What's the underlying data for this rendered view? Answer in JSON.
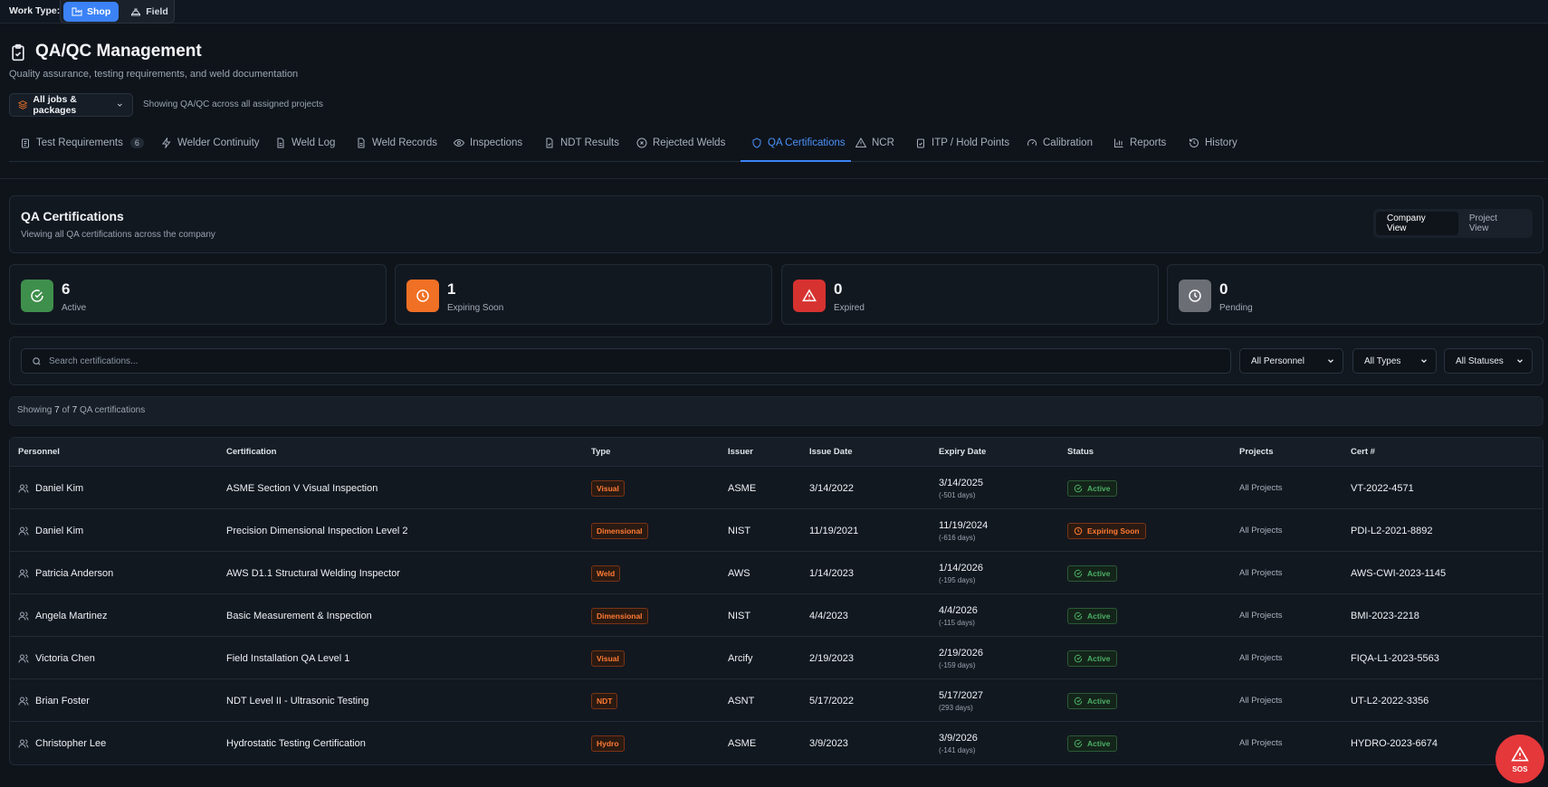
{
  "work_type": {
    "label": "Work Type:",
    "options": [
      {
        "label": "Shop",
        "icon": "factory-icon",
        "active": true
      },
      {
        "label": "Field",
        "icon": "hardhat-icon",
        "active": false
      }
    ]
  },
  "header": {
    "title": "QA/QC Management",
    "subtitle": "Quality assurance, testing requirements, and weld documentation",
    "scope_button": "All jobs & packages",
    "scope_note": "Showing QA/QC across all assigned projects"
  },
  "tabs": [
    {
      "label": "Test Requirements",
      "count": "6",
      "icon": "clipboard-icon"
    },
    {
      "label": "Welder Continuity",
      "icon": "zap-icon"
    },
    {
      "label": "Weld Log",
      "icon": "file-icon"
    },
    {
      "label": "Weld Records",
      "icon": "file-icon"
    },
    {
      "label": "Inspections",
      "icon": "eye-icon"
    },
    {
      "label": "NDT Results",
      "icon": "file-check-icon"
    },
    {
      "label": "Rejected Welds",
      "icon": "x-circle-icon"
    },
    {
      "label": "QA Certifications",
      "icon": "shield-icon",
      "active": true
    },
    {
      "label": "NCR",
      "icon": "warning-icon"
    },
    {
      "label": "ITP / Hold Points",
      "icon": "clipboard-check-icon"
    },
    {
      "label": "Calibration",
      "icon": "gauge-icon"
    },
    {
      "label": "Reports",
      "icon": "bar-chart-icon"
    },
    {
      "label": "History",
      "icon": "history-icon"
    }
  ],
  "section": {
    "title": "QA Certifications",
    "subtitle": "Viewing all QA certifications across the company",
    "views": [
      {
        "label": "Company View",
        "active": true
      },
      {
        "label": "Project View",
        "active": false
      }
    ]
  },
  "stats": [
    {
      "value": "6",
      "label": "Active",
      "color": "#3f8f4c",
      "icon": "check-circle-icon"
    },
    {
      "value": "1",
      "label": "Expiring Soon",
      "color": "#f07025",
      "icon": "clock-icon"
    },
    {
      "value": "0",
      "label": "Expired",
      "color": "#d63230",
      "icon": "warning-icon"
    },
    {
      "value": "0",
      "label": "Pending",
      "color": "#6b6f75",
      "icon": "clock-icon"
    }
  ],
  "filters": {
    "search_placeholder": "Search certifications...",
    "personnel": "All Personnel",
    "types": "All Types",
    "statuses": "All Statuses"
  },
  "showing": {
    "prefix": "Showing ",
    "shown": "7",
    "mid": " of ",
    "total": "7",
    "suffix": " QA certifications"
  },
  "table": {
    "headers": [
      "Personnel",
      "Certification",
      "Type",
      "Issuer",
      "Issue Date",
      "Expiry Date",
      "Status",
      "Projects",
      "Cert #"
    ],
    "rows": [
      {
        "personnel": "Daniel Kim",
        "certification": "ASME Section V Visual Inspection",
        "type": "Visual",
        "issuer": "ASME",
        "issue_date": "3/14/2022",
        "expiry_date": "3/14/2025",
        "expiry_days": "(-501 days)",
        "status": "Active",
        "projects": "All Projects",
        "cert_no": "VT-2022-4571"
      },
      {
        "personnel": "Daniel Kim",
        "certification": "Precision Dimensional Inspection Level 2",
        "type": "Dimensional",
        "issuer": "NIST",
        "issue_date": "11/19/2021",
        "expiry_date": "11/19/2024",
        "expiry_days": "(-616 days)",
        "status": "Expiring Soon",
        "projects": "All Projects",
        "cert_no": "PDI-L2-2021-8892"
      },
      {
        "personnel": "Patricia Anderson",
        "certification": "AWS D1.1 Structural Welding Inspector",
        "type": "Weld",
        "issuer": "AWS",
        "issue_date": "1/14/2023",
        "expiry_date": "1/14/2026",
        "expiry_days": "(-195 days)",
        "status": "Active",
        "projects": "All Projects",
        "cert_no": "AWS-CWI-2023-1145"
      },
      {
        "personnel": "Angela Martinez",
        "certification": "Basic Measurement & Inspection",
        "type": "Dimensional",
        "issuer": "NIST",
        "issue_date": "4/4/2023",
        "expiry_date": "4/4/2026",
        "expiry_days": "(-115 days)",
        "status": "Active",
        "projects": "All Projects",
        "cert_no": "BMI-2023-2218"
      },
      {
        "personnel": "Victoria Chen",
        "certification": "Field Installation QA Level 1",
        "type": "Visual",
        "issuer": "Arcify",
        "issue_date": "2/19/2023",
        "expiry_date": "2/19/2026",
        "expiry_days": "(-159 days)",
        "status": "Active",
        "projects": "All Projects",
        "cert_no": "FIQA-L1-2023-5563"
      },
      {
        "personnel": "Brian Foster",
        "certification": "NDT Level II - Ultrasonic Testing",
        "type": "NDT",
        "issuer": "ASNT",
        "issue_date": "5/17/2022",
        "expiry_date": "5/17/2027",
        "expiry_days": "(293 days)",
        "status": "Active",
        "projects": "All Projects",
        "cert_no": "UT-L2-2022-3356"
      },
      {
        "personnel": "Christopher Lee",
        "certification": "Hydrostatic Testing Certification",
        "type": "Hydro",
        "issuer": "ASME",
        "issue_date": "3/9/2023",
        "expiry_date": "3/9/2026",
        "expiry_days": "(-141 days)",
        "status": "Active",
        "projects": "All Projects",
        "cert_no": "HYDRO-2023-6674"
      }
    ]
  },
  "sos": {
    "label": "SOS"
  }
}
